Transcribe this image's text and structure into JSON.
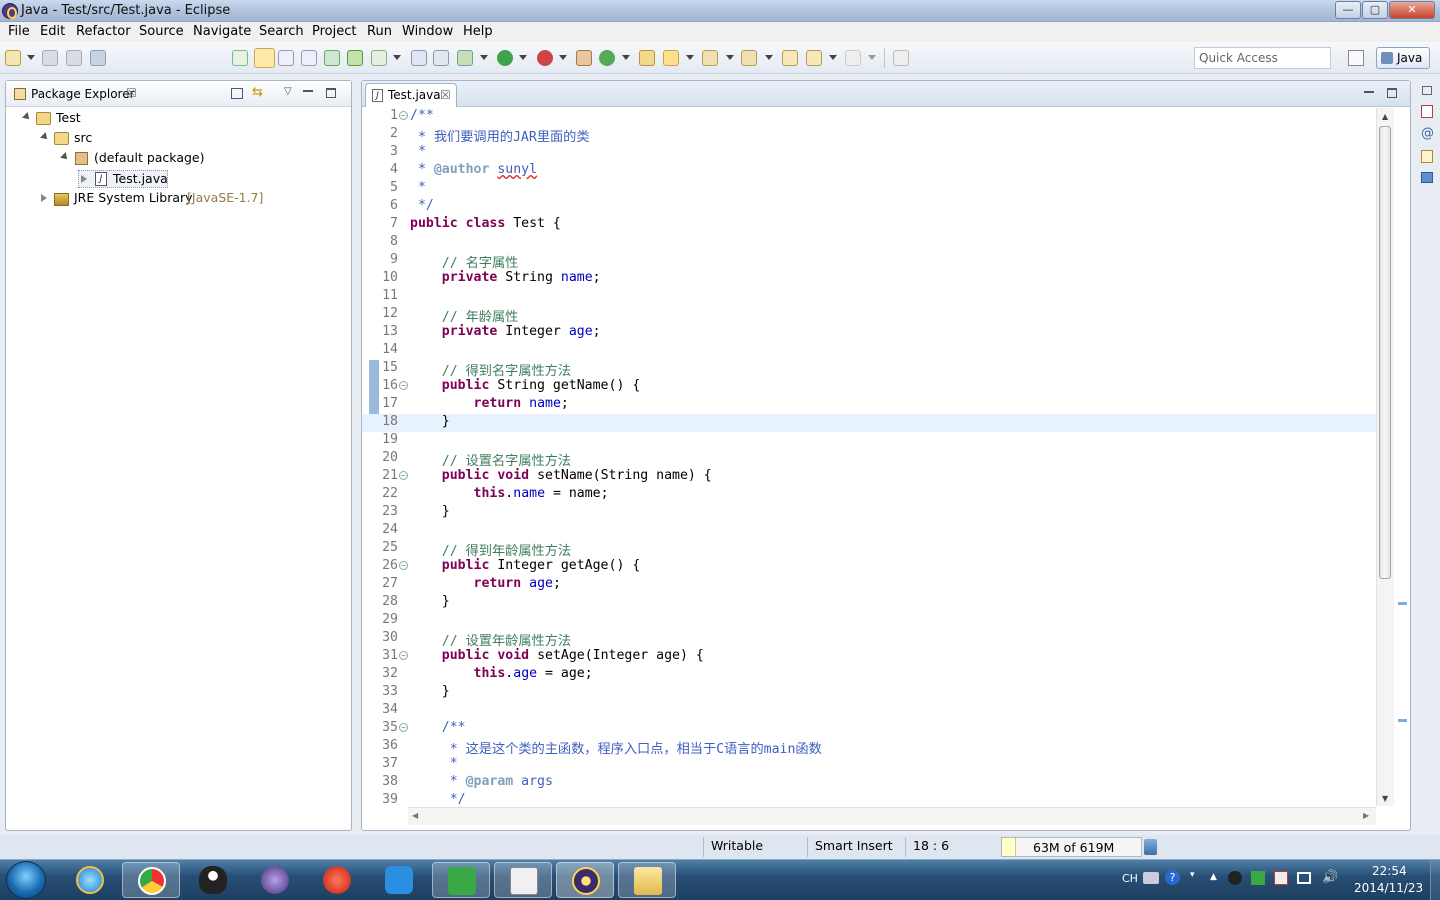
{
  "window": {
    "title": "Java - Test/src/Test.java - Eclipse",
    "min_label": "—",
    "max_label": "▢",
    "close_label": "✕"
  },
  "menu": [
    "File",
    "Edit",
    "Refactor",
    "Source",
    "Navigate",
    "Search",
    "Project",
    "Run",
    "Window",
    "Help"
  ],
  "toolbar": {
    "quick_access_placeholder": "Quick Access",
    "perspective": "Java"
  },
  "package_explorer": {
    "tab_label": "Package Explorer",
    "tree": [
      {
        "label": "Test",
        "type": "project",
        "expanded": true
      },
      {
        "label": "src",
        "type": "source-folder",
        "expanded": true
      },
      {
        "label": "(default package)",
        "type": "package",
        "expanded": true
      },
      {
        "label": "Test.java",
        "type": "java-file",
        "expanded": false
      },
      {
        "label": "JRE System Library",
        "suffix": "[JavaSE-1.7]",
        "type": "library",
        "expanded": false
      }
    ]
  },
  "editor": {
    "tab_label": "Test.java",
    "line_numbers": [
      "1",
      "2",
      "3",
      "4",
      "5",
      "6",
      "7",
      "8",
      "9",
      "10",
      "11",
      "12",
      "13",
      "14",
      "15",
      "16",
      "17",
      "18",
      "19",
      "20",
      "21",
      "22",
      "23",
      "24",
      "25",
      "26",
      "27",
      "28",
      "29",
      "30",
      "31",
      "32",
      "33",
      "34",
      "35",
      "36",
      "37",
      "38",
      "39"
    ],
    "lines": [
      "/**",
      " * 我们要调用的JAR里面的类",
      " *",
      " * @author sunyl",
      " *",
      " */",
      "public class Test {",
      "",
      "    // 名字属性",
      "    private String name;",
      "",
      "    // 年龄属性",
      "    private Integer age;",
      "",
      "    // 得到名字属性方法",
      "    public String getName() {",
      "        return name;",
      "    }",
      "",
      "    // 设置名字属性方法",
      "    public void setName(String name) {",
      "        this.name = name;",
      "    }",
      "",
      "    // 得到年龄属性方法",
      "    public Integer getAge() {",
      "        return age;",
      "    }",
      "",
      "    // 设置年龄属性方法",
      "    public void setAge(Integer age) {",
      "        this.age = age;",
      "    }",
      "",
      "    /**",
      "     * 这是这个类的主函数，程序入口点，相当于C语言的main函数",
      "     *",
      "     * @param args",
      "     */"
    ],
    "fold_lines": [
      "1",
      "16",
      "21",
      "26",
      "31",
      "35"
    ],
    "current_line": "18"
  },
  "status": {
    "writable": "Writable",
    "insert_mode": "Smart Insert",
    "position": "18 : 6",
    "heap": "63M of 619M",
    "heap_used_fraction": 0.1
  },
  "taskbar": {
    "apps": [
      "start-button",
      "internet-explorer",
      "chrome",
      "qq",
      "eclipse-alt",
      "app-red",
      "app-blue",
      "app-green",
      "datasnap",
      "eclipse",
      "explorer"
    ],
    "tray_lang": "CH",
    "time": "22:54",
    "date": "2014/11/23"
  },
  "colors": {
    "keyword": "#7f0055",
    "comment": "#3f7f5f",
    "javadoc": "#3f5fbf",
    "field": "#0000c0",
    "current_line": "#e8f2fe"
  }
}
